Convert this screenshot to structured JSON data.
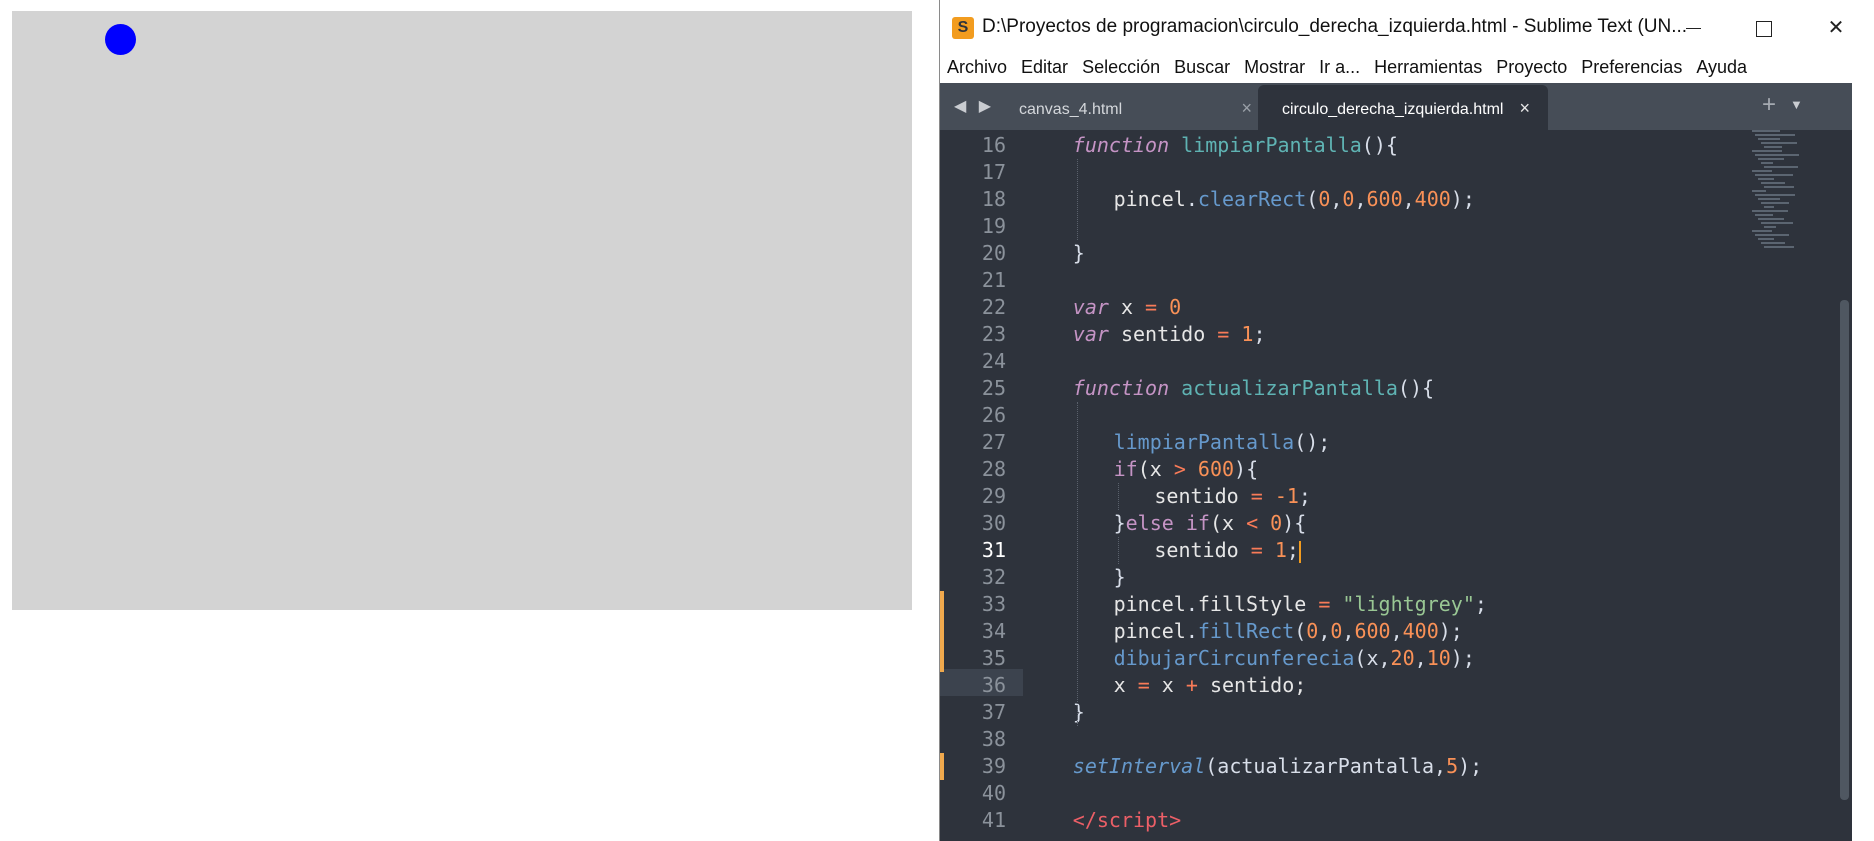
{
  "canvas": {
    "background": "#d3d3d3",
    "ball_color": "#0000ff"
  },
  "window": {
    "title": "D:\\Proyectos de programacion\\circulo_derecha_izquierda.html - Sublime Text (UN...",
    "icon": "sublime-text-icon",
    "controls": {
      "minimize": "minimize-icon",
      "maximize": "maximize-icon",
      "close": "✕"
    }
  },
  "menu": [
    "Archivo",
    "Editar",
    "Selección",
    "Buscar",
    "Mostrar",
    "Ir a...",
    "Herramientas",
    "Proyecto",
    "Preferencias",
    "Ayuda"
  ],
  "tabs": [
    {
      "label": "canvas_4.html",
      "close": "×",
      "active": false
    },
    {
      "label": "circulo_derecha_izquierda.html",
      "close": "×",
      "active": true
    }
  ],
  "tab_bar": {
    "nav": "◀ ▶",
    "plus": "+",
    "dropdown": "▼"
  },
  "editor": {
    "line_numbers": [
      "16",
      "17",
      "18",
      "19",
      "20",
      "21",
      "22",
      "23",
      "24",
      "25",
      "26",
      "27",
      "28",
      "29",
      "30",
      "31",
      "32",
      "33",
      "34",
      "35",
      "36",
      "37",
      "38",
      "39",
      "40",
      "41"
    ],
    "current_line": "31",
    "modified_lines": [
      "33",
      "34",
      "35",
      "39"
    ],
    "lines": [
      [
        {
          "t": "function",
          "c": "kw"
        },
        {
          "t": " "
        },
        {
          "t": "limpiarPantalla",
          "c": "fn"
        },
        {
          "t": "(){",
          "c": "punc"
        }
      ],
      [],
      [
        {
          "t": "pincel"
        },
        {
          "t": ".",
          "c": "punc"
        },
        {
          "t": "clearRect",
          "c": "call"
        },
        {
          "t": "(",
          "c": "punc"
        },
        {
          "t": "0",
          "c": "num"
        },
        {
          "t": ",",
          "c": "punc"
        },
        {
          "t": "0",
          "c": "num"
        },
        {
          "t": ",",
          "c": "punc"
        },
        {
          "t": "600",
          "c": "num"
        },
        {
          "t": ",",
          "c": "punc"
        },
        {
          "t": "400",
          "c": "num"
        },
        {
          "t": ");",
          "c": "punc"
        }
      ],
      [],
      [
        {
          "t": "}",
          "c": "punc"
        }
      ],
      [],
      [
        {
          "t": "var",
          "c": "kw"
        },
        {
          "t": " x "
        },
        {
          "t": "=",
          "c": "op"
        },
        {
          "t": " "
        },
        {
          "t": "0",
          "c": "num"
        }
      ],
      [
        {
          "t": "var",
          "c": "kw"
        },
        {
          "t": " sentido "
        },
        {
          "t": "=",
          "c": "op"
        },
        {
          "t": " "
        },
        {
          "t": "1",
          "c": "num"
        },
        {
          "t": ";",
          "c": "punc"
        }
      ],
      [],
      [
        {
          "t": "function",
          "c": "kw"
        },
        {
          "t": " "
        },
        {
          "t": "actualizarPantalla",
          "c": "fn"
        },
        {
          "t": "(){",
          "c": "punc"
        }
      ],
      [],
      [
        {
          "t": "limpiarPantalla",
          "c": "call"
        },
        {
          "t": "();",
          "c": "punc"
        }
      ],
      [
        {
          "t": "if",
          "c": "kw2"
        },
        {
          "t": "(x "
        },
        {
          "t": ">",
          "c": "op"
        },
        {
          "t": " "
        },
        {
          "t": "600",
          "c": "num"
        },
        {
          "t": "){",
          "c": "punc"
        }
      ],
      [
        {
          "t": "sentido "
        },
        {
          "t": "=",
          "c": "op"
        },
        {
          "t": " "
        },
        {
          "t": "-1",
          "c": "num"
        },
        {
          "t": ";",
          "c": "punc"
        }
      ],
      [
        {
          "t": "}",
          "c": "punc"
        },
        {
          "t": "else",
          "c": "kw2"
        },
        {
          "t": " "
        },
        {
          "t": "if",
          "c": "kw2"
        },
        {
          "t": "(x "
        },
        {
          "t": "<",
          "c": "op"
        },
        {
          "t": " "
        },
        {
          "t": "0",
          "c": "num"
        },
        {
          "t": "){",
          "c": "punc"
        }
      ],
      [
        {
          "t": "sentido "
        },
        {
          "t": "=",
          "c": "op"
        },
        {
          "t": " "
        },
        {
          "t": "1",
          "c": "num"
        },
        {
          "t": ";",
          "c": "punc"
        },
        {
          "t": "",
          "c": "cursor"
        }
      ],
      [
        {
          "t": "}",
          "c": "punc"
        }
      ],
      [
        {
          "t": "pincel"
        },
        {
          "t": ".",
          "c": "punc"
        },
        {
          "t": "fillStyle"
        },
        {
          "t": " "
        },
        {
          "t": "=",
          "c": "op"
        },
        {
          "t": " "
        },
        {
          "t": "\"lightgrey\"",
          "c": "str"
        },
        {
          "t": ";",
          "c": "punc"
        }
      ],
      [
        {
          "t": "pincel"
        },
        {
          "t": ".",
          "c": "punc"
        },
        {
          "t": "fillRect",
          "c": "call"
        },
        {
          "t": "(",
          "c": "punc"
        },
        {
          "t": "0",
          "c": "num"
        },
        {
          "t": ",",
          "c": "punc"
        },
        {
          "t": "0",
          "c": "num"
        },
        {
          "t": ",",
          "c": "punc"
        },
        {
          "t": "600",
          "c": "num"
        },
        {
          "t": ",",
          "c": "punc"
        },
        {
          "t": "400",
          "c": "num"
        },
        {
          "t": ");",
          "c": "punc"
        }
      ],
      [
        {
          "t": "dibujarCircunferecia",
          "c": "call"
        },
        {
          "t": "(x,",
          "c": "punc"
        },
        {
          "t": "20",
          "c": "num"
        },
        {
          "t": ",",
          "c": "punc"
        },
        {
          "t": "10",
          "c": "num"
        },
        {
          "t": ");",
          "c": "punc"
        }
      ],
      [
        {
          "t": "x "
        },
        {
          "t": "=",
          "c": "op"
        },
        {
          "t": " x "
        },
        {
          "t": "+",
          "c": "op"
        },
        {
          "t": " sentido;"
        }
      ],
      [
        {
          "t": "}",
          "c": "punc"
        }
      ],
      [],
      [
        {
          "t": "setInterval",
          "c": "callit"
        },
        {
          "t": "(actualizarPantalla,",
          "c": "punc"
        },
        {
          "t": "5",
          "c": "num"
        },
        {
          "t": ");",
          "c": "punc"
        }
      ],
      [],
      [
        {
          "t": "</",
          "c": "tag"
        },
        {
          "t": "script",
          "c": "tag"
        },
        {
          "t": ">",
          "c": "tag"
        }
      ]
    ]
  }
}
